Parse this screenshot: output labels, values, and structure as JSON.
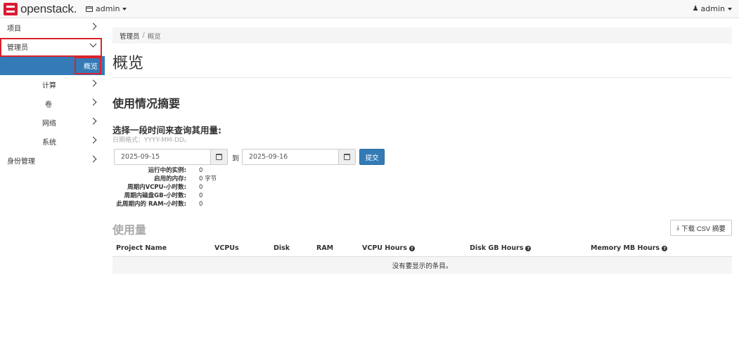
{
  "header": {
    "logo_text": "openstack.",
    "project_label": "admin",
    "user_label": "admin"
  },
  "sidebar": {
    "items": [
      {
        "label": "项目"
      },
      {
        "label": "管理员"
      },
      {
        "label": "概览"
      },
      {
        "label": "计算"
      },
      {
        "label": "卷"
      },
      {
        "label": "网络"
      },
      {
        "label": "系统"
      },
      {
        "label": "身份管理"
      }
    ]
  },
  "breadcrumb": {
    "parent": "管理员",
    "separator": "/",
    "current": "概览"
  },
  "page": {
    "title": "概览",
    "usage_heading": "使用情况摘要",
    "select_heading": "选择一段时间来查询其用量:",
    "date_hint": "日期格式：YYYY-MM-DD。",
    "start_date": "2025-09-15",
    "to_label": "到",
    "end_date": "2025-09-16",
    "submit_label": "提交"
  },
  "stats": [
    {
      "label": "运行中的实例:",
      "value": "0"
    },
    {
      "label": "启用的内存:",
      "value": "0 字节"
    },
    {
      "label": "周期内VCPU-小时数:",
      "value": "0"
    },
    {
      "label": "周期内磁盘GB-小时数:",
      "value": "0"
    },
    {
      "label": "此周期内的 RAM-小时数:",
      "value": "0"
    }
  ],
  "usage_table": {
    "heading": "使用量",
    "csv_button": "下载 CSV 摘要",
    "columns": [
      "Project Name",
      "VCPUs",
      "Disk",
      "RAM",
      "VCPU Hours",
      "Disk GB Hours",
      "Memory MB Hours"
    ],
    "empty_message": "没有要显示的条目。"
  },
  "colors": {
    "brand_red": "#da1a32",
    "primary_blue": "#337ab7",
    "highlight_red": "#d9232d"
  }
}
